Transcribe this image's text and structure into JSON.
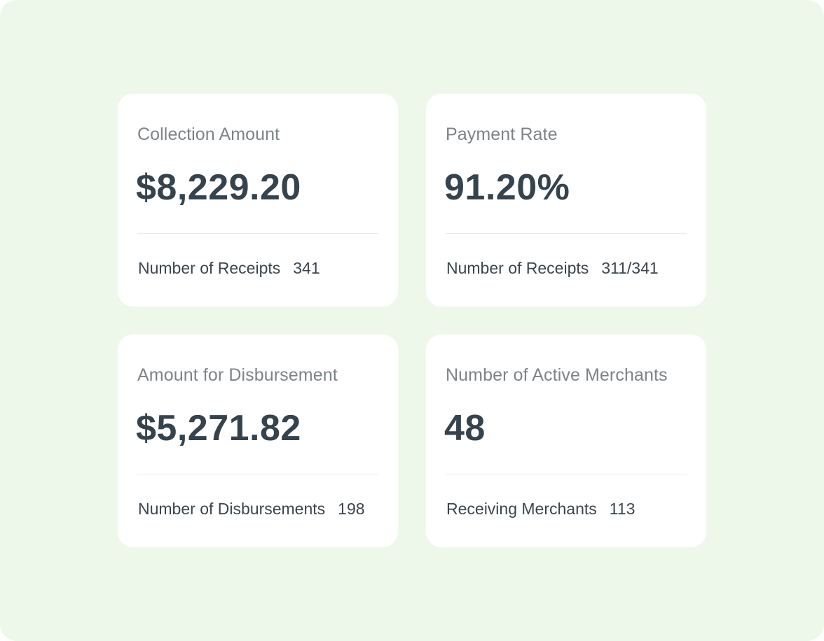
{
  "colors": {
    "background": "#eef8ea",
    "card": "#ffffff",
    "title_text": "#7d8488",
    "value_text": "#35434e",
    "footer_text": "#3a4650",
    "divider": "#e6eaec"
  },
  "cards": [
    {
      "title": "Collection Amount",
      "value": "$8,229.20",
      "footer_label": "Number of Receipts",
      "footer_count": "341"
    },
    {
      "title": "Payment Rate",
      "value": "91.20%",
      "footer_label": "Number of Receipts",
      "footer_count": "311/341"
    },
    {
      "title": "Amount for Disbursement",
      "value": "$5,271.82",
      "footer_label": "Number of Disbursements",
      "footer_count": "198"
    },
    {
      "title": "Number of Active Merchants",
      "value": "48",
      "footer_label": "Receiving Merchants",
      "footer_count": "113"
    }
  ]
}
